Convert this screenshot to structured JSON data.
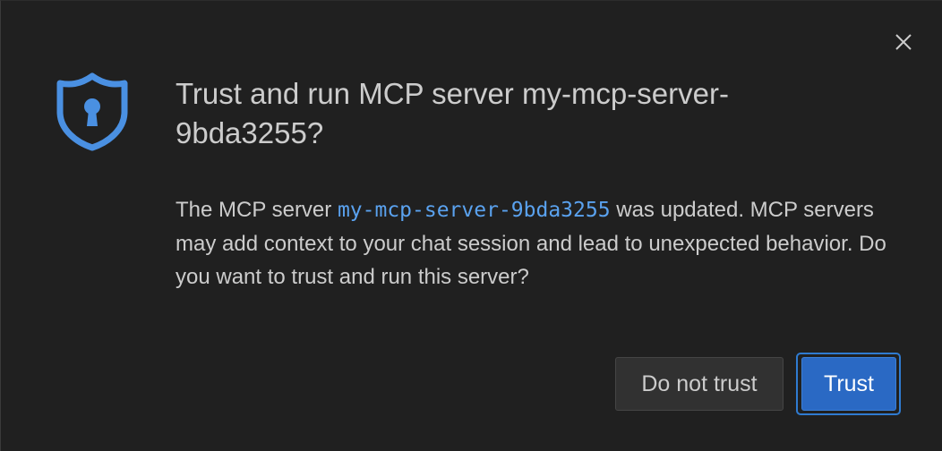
{
  "dialog": {
    "title": "Trust and run MCP server my-mcp-server-9bda3255?",
    "message": {
      "before": "The MCP server ",
      "server_name": "my-mcp-server-9bda3255",
      "after": " was updated. MCP servers may add context to your chat session and lead to unexpected behavior. Do you want to trust and run this server?"
    },
    "icon": "shield-lock-icon",
    "close_icon": "close-icon"
  },
  "buttons": {
    "do_not_trust": "Do not trust",
    "trust": "Trust"
  },
  "colors": {
    "background": "#202020",
    "text": "#cccccc",
    "accent": "#5aa2ef",
    "icon": "#4a90e2",
    "primary_button": "#2a69c4",
    "secondary_button": "#313131"
  }
}
